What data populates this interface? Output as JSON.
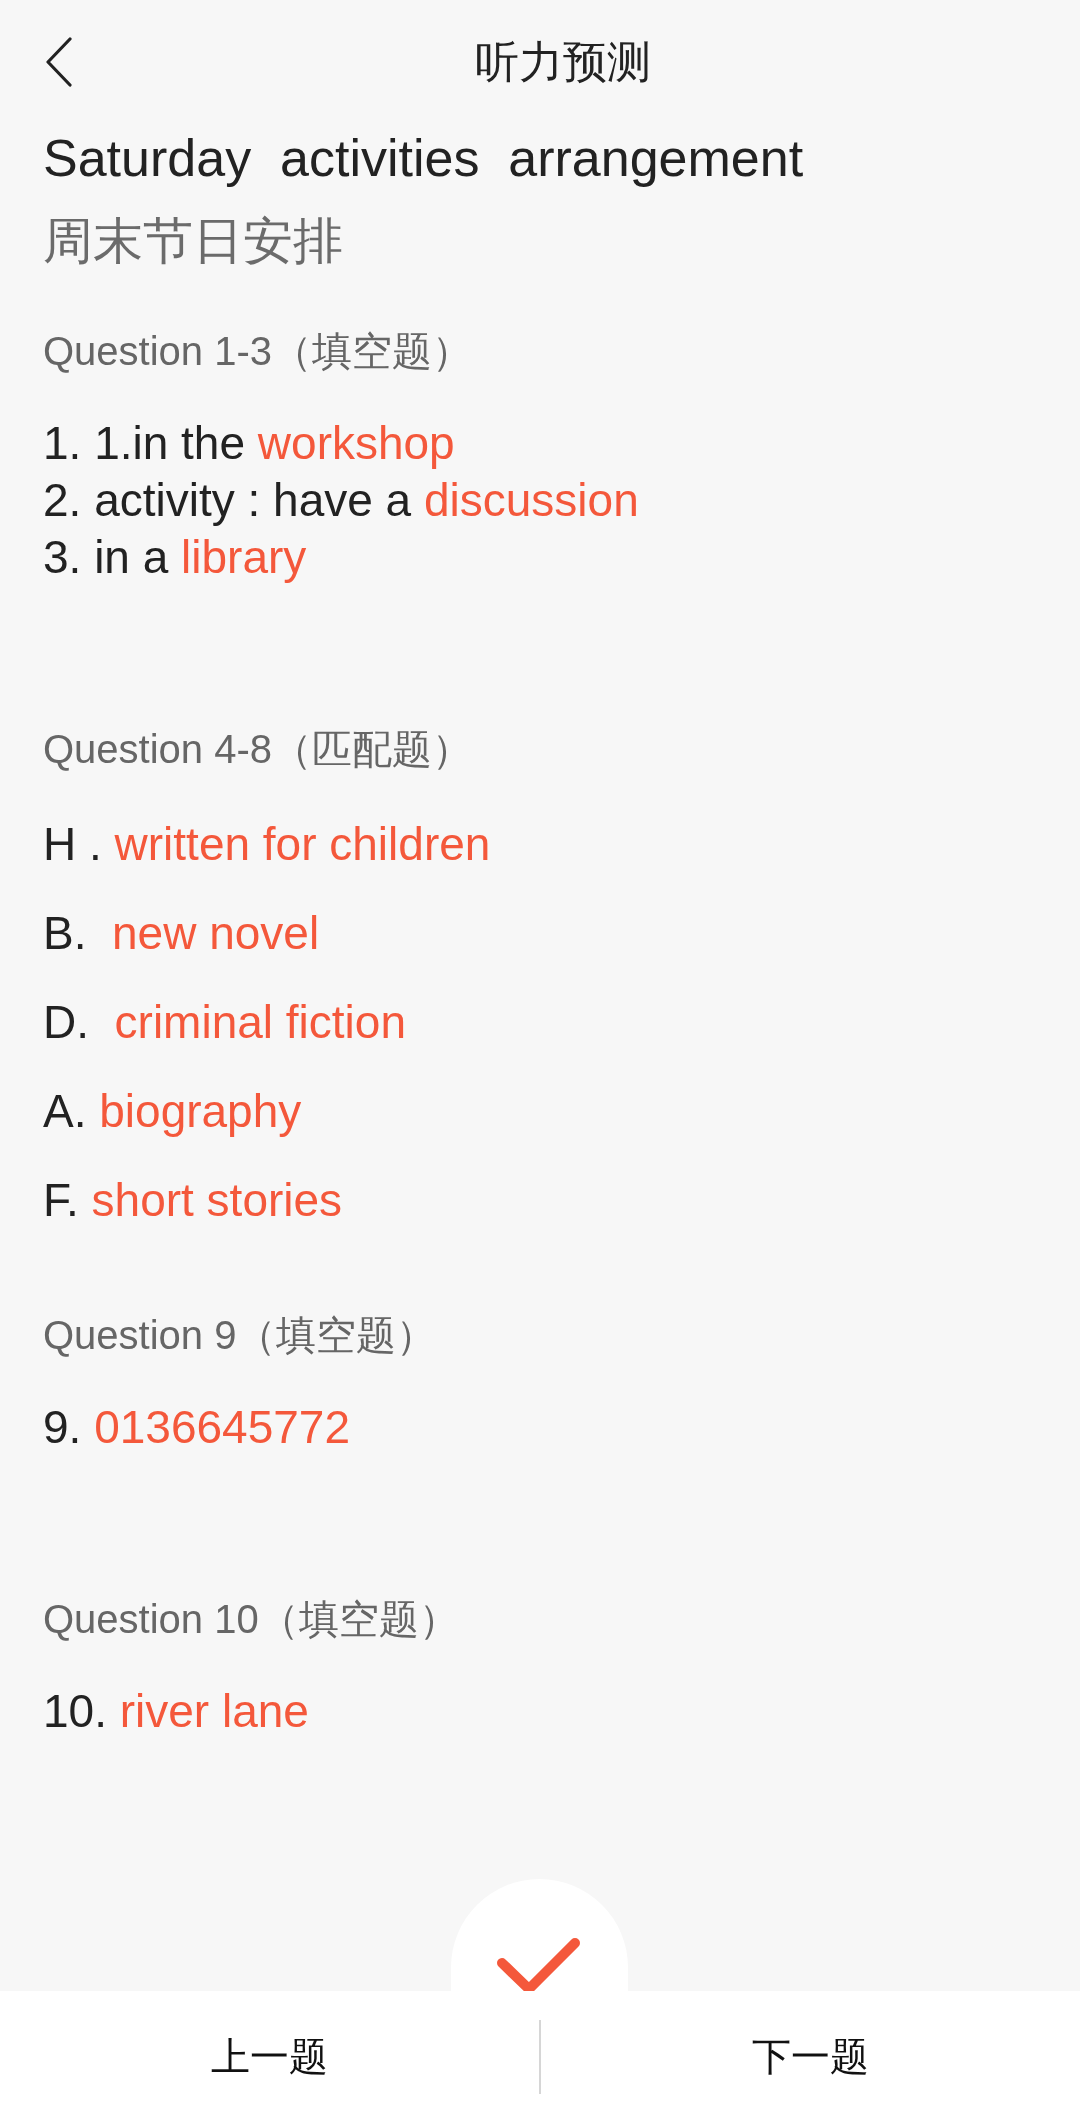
{
  "header": {
    "title": "听力预测"
  },
  "passage": {
    "title": "Saturday  activities  arrangement",
    "subtitle": "周末节日安排"
  },
  "sections": [
    {
      "heading": "Question 1-3（填空题）",
      "kind": "fill",
      "items": [
        {
          "prefix": "1. 1.in the",
          "answer": "workshop"
        },
        {
          "prefix": "2. activity : have a",
          "answer": "discussion"
        },
        {
          "prefix": "3. in a",
          "answer": "library"
        }
      ]
    },
    {
      "heading": "Question 4-8（匹配题）",
      "kind": "match",
      "items": [
        {
          "prefix": "H .",
          "answer": "written for children"
        },
        {
          "prefix": "B. ",
          "answer": "new novel"
        },
        {
          "prefix": "D. ",
          "answer": "criminal fiction"
        },
        {
          "prefix": "A.",
          "answer": "biography"
        },
        {
          "prefix": "F.",
          "answer": "short stories"
        }
      ]
    },
    {
      "heading": "Question 9（填空题）",
      "kind": "fill",
      "items": [
        {
          "prefix": "9.",
          "answer": "0136645772"
        }
      ]
    },
    {
      "heading": "Question 10（填空题）",
      "kind": "fill",
      "items": [
        {
          "prefix": "10.",
          "answer": "river lane"
        }
      ]
    }
  ],
  "bottom_bar": {
    "buttons": [
      "上一题",
      "下一题"
    ]
  }
}
